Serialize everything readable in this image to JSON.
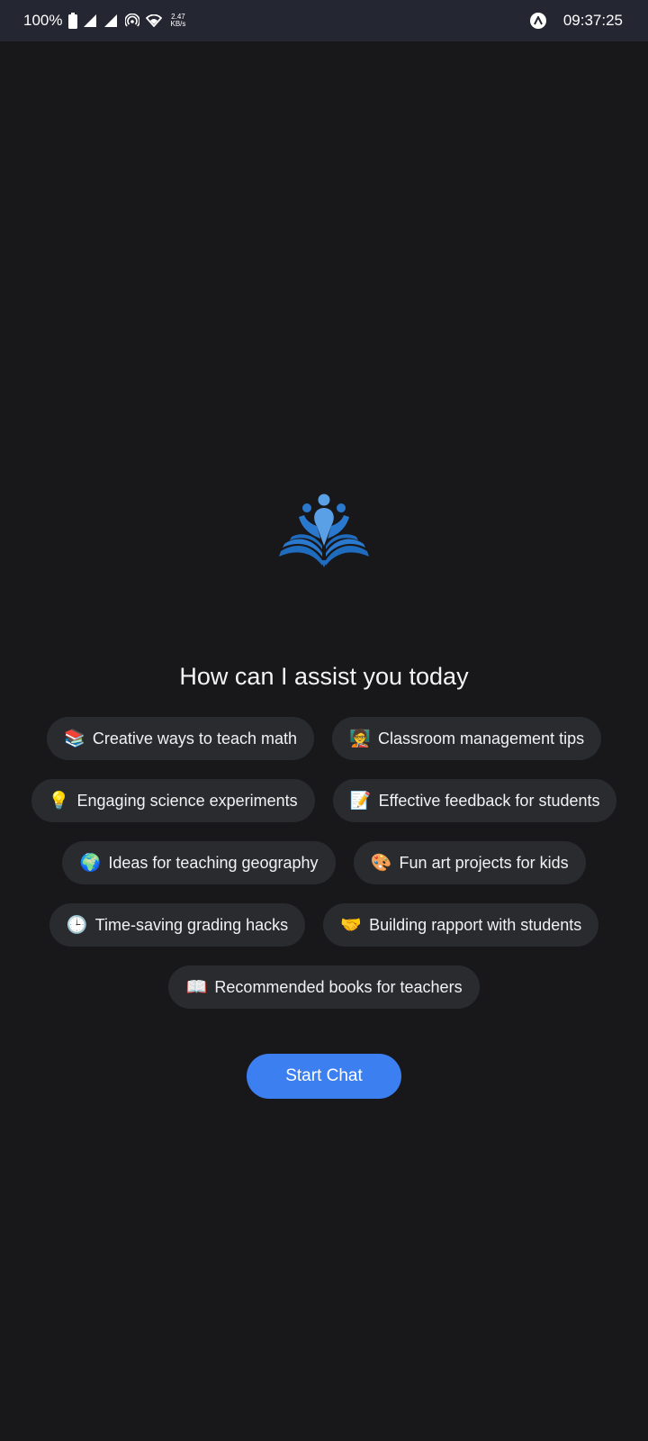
{
  "status_bar": {
    "battery_percent": "100%",
    "net_speed_value": "2.47",
    "net_speed_unit": "KB/s",
    "time": "09:37:25"
  },
  "main": {
    "heading": "How can I assist you today",
    "start_button": "Start Chat",
    "chip_rows": [
      [
        {
          "emoji": "📚",
          "label": "Creative ways to teach math"
        },
        {
          "emoji": "🧑‍🏫",
          "label": "Classroom management tips"
        }
      ],
      [
        {
          "emoji": "💡",
          "label": "Engaging science experiments"
        },
        {
          "emoji": "📝",
          "label": "Effective feedback for students"
        }
      ],
      [
        {
          "emoji": "🌍",
          "label": "Ideas for teaching geography"
        },
        {
          "emoji": "🎨",
          "label": "Fun art projects for kids"
        }
      ],
      [
        {
          "emoji": "🕒",
          "label": "Time-saving grading hacks"
        },
        {
          "emoji": "🤝",
          "label": "Building rapport with students"
        }
      ],
      [
        {
          "emoji": "📖",
          "label": "Recommended books for teachers"
        }
      ]
    ]
  },
  "colors": {
    "background": "#18181b",
    "status_bar": "#242631",
    "chip": "#2a2b2f",
    "accent": "#3b7ff0",
    "logo_light": "#5aa0e6",
    "logo_dark": "#1f6cbf"
  },
  "icons": [
    "battery-icon",
    "signal-icon",
    "hotspot-icon",
    "wifi-icon",
    "brand-icon",
    "logo-icon"
  ]
}
